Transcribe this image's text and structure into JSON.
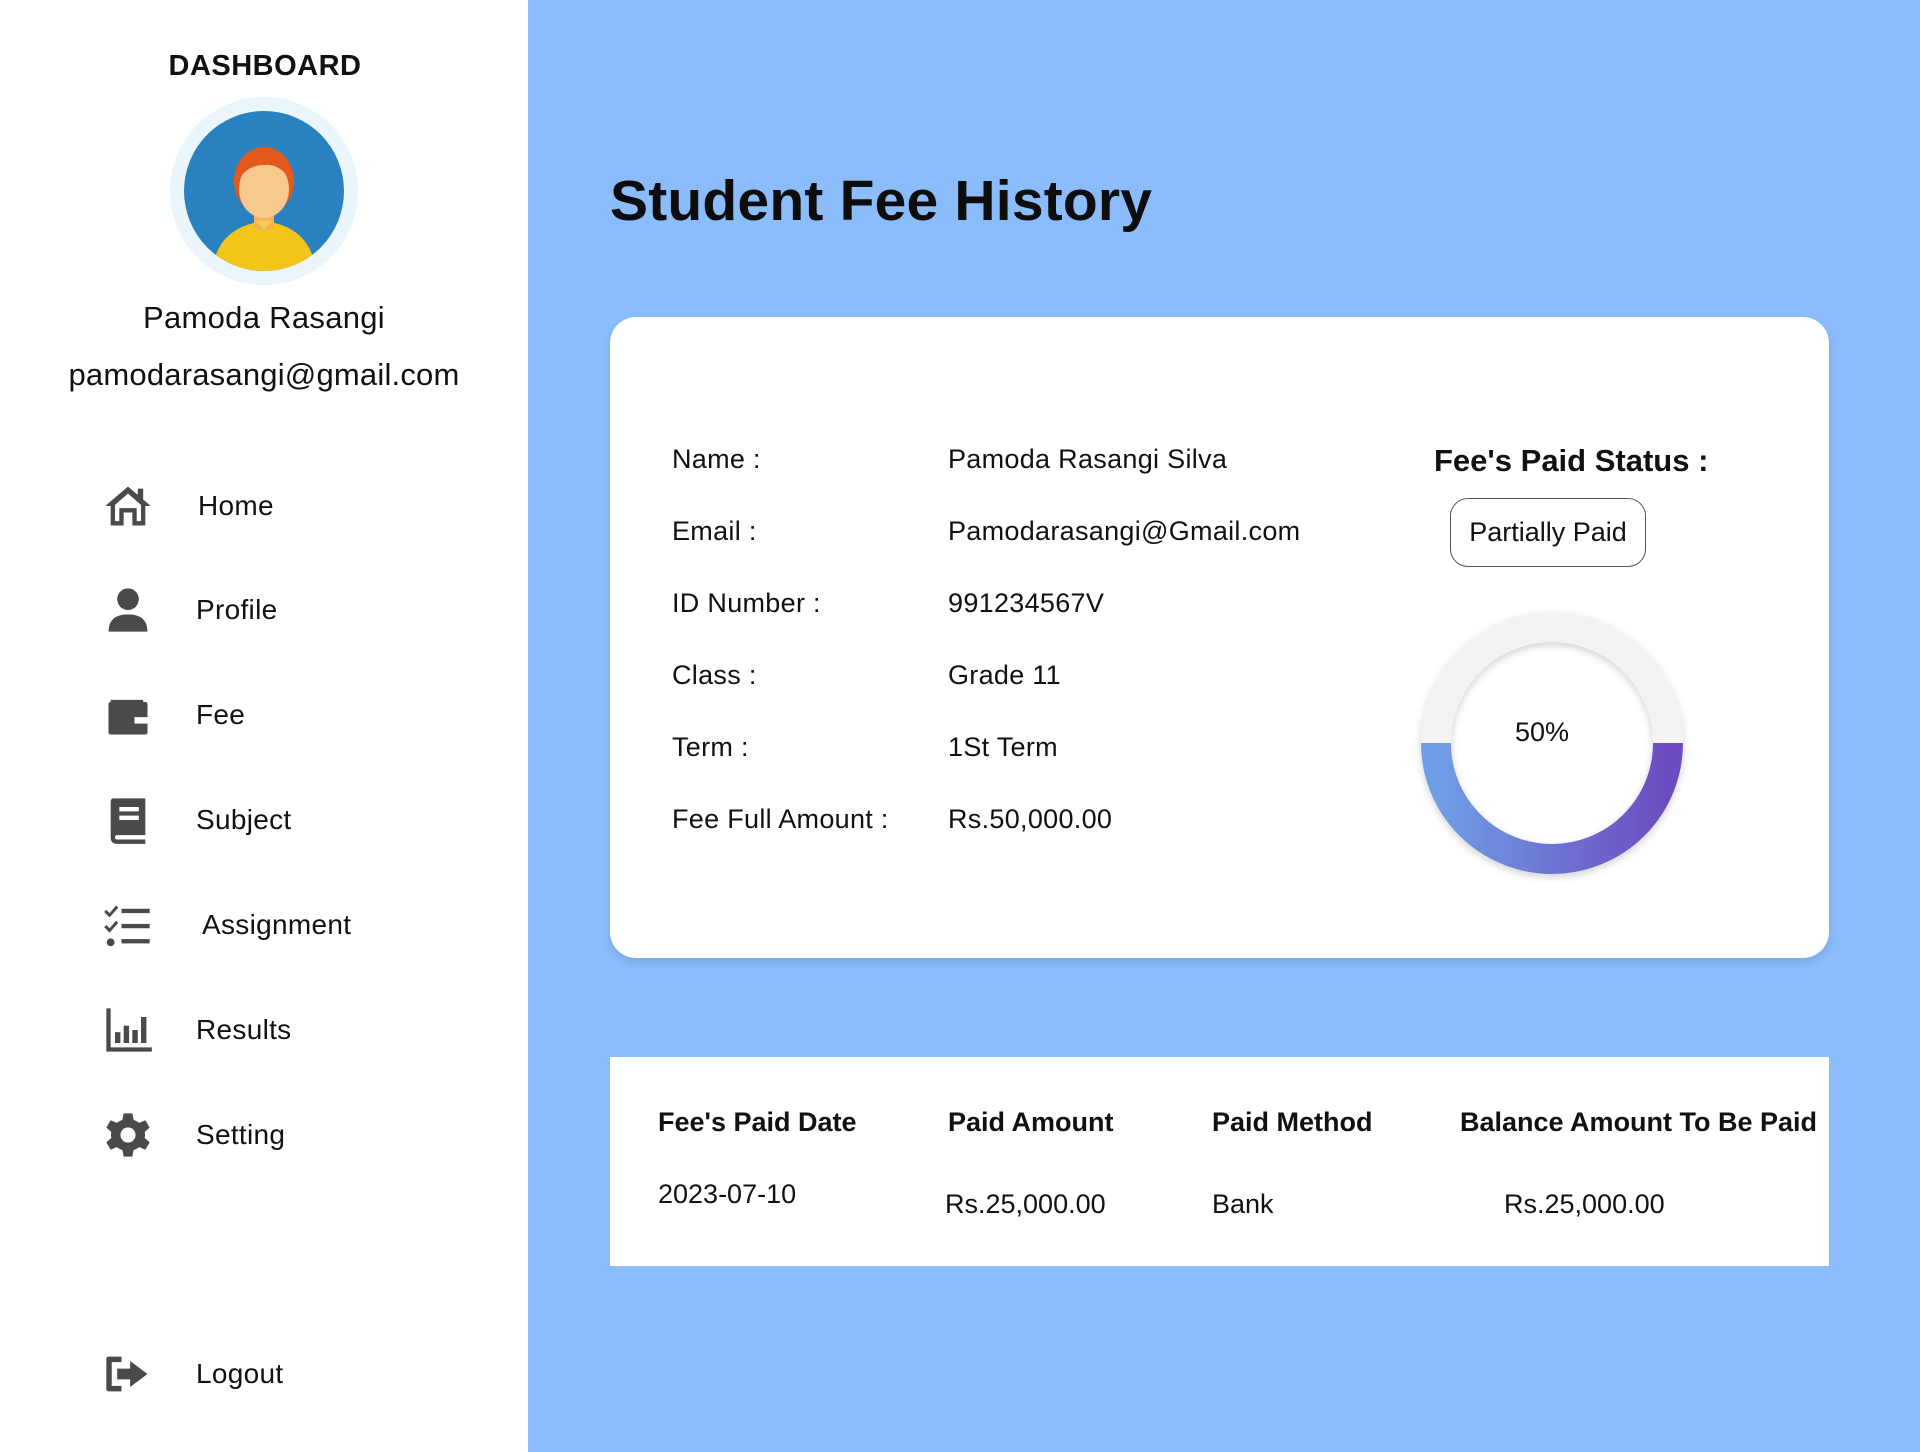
{
  "sidebar": {
    "title": "DASHBOARD",
    "user_name": "Pamoda Rasangi",
    "user_email": "pamodarasangi@gmail.com",
    "items": [
      {
        "label": "Home",
        "icon": "home-icon"
      },
      {
        "label": "Profile",
        "icon": "user-icon"
      },
      {
        "label": "Fee",
        "icon": "wallet-icon"
      },
      {
        "label": "Subject",
        "icon": "book-icon"
      },
      {
        "label": "Assignment",
        "icon": "checklist-icon"
      },
      {
        "label": "Results",
        "icon": "bar-chart-icon"
      },
      {
        "label": "Setting",
        "icon": "gear-icon"
      }
    ],
    "logout_label": "Logout"
  },
  "main": {
    "title": "Student Fee History",
    "details": [
      {
        "key": "Name :",
        "value": "Pamoda Rasangi Silva"
      },
      {
        "key": "Email :",
        "value": "Pamodarasangi@Gmail.com"
      },
      {
        "key": "ID Number :",
        "value": "991234567V"
      },
      {
        "key": "Class :",
        "value": "Grade 11"
      },
      {
        "key": "Term :",
        "value": "1St Term"
      },
      {
        "key": "Fee Full Amount :",
        "value": "Rs.50,000.00"
      }
    ],
    "status_title": "Fee's Paid Status :",
    "status_value": "Partially Paid",
    "progress_label": "50%",
    "progress_fraction": 0.5,
    "table": {
      "headers": [
        "Fee's Paid Date",
        "Paid Amount",
        "Paid Method",
        "Balance Amount To Be Paid"
      ],
      "rows": [
        [
          "2023-07-10",
          "Rs.25,000.00",
          "Bank",
          "Rs.25,000.00"
        ]
      ]
    }
  },
  "colors": {
    "background": "#8bbdfd",
    "sidebar": "#ffffff",
    "progress_start": "#6f9ee6",
    "progress_end": "#6c4cc0"
  }
}
